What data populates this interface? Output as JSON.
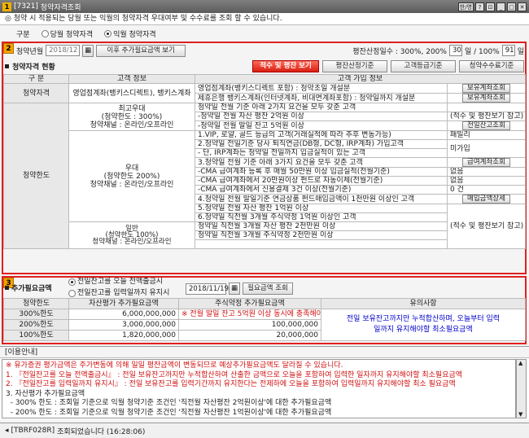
{
  "window": {
    "screen_no": "7321",
    "title": "청약자격조회",
    "btn_lang": "한/영",
    "btn_help": "?"
  },
  "notice": "◎ 청약 시 적용되는 당월 또는 익월의 청약자격 우대여부 및 수수료를 조회 할 수 있습니다.",
  "type_row": {
    "label": "구분",
    "opt1": "당월 청약자격",
    "opt2": "익월 청약자격"
  },
  "section2": {
    "badge": "2",
    "ym_label": "청약년월",
    "ym_value": "2018/12",
    "btn_need": "이후 추가필요금액 보기",
    "avg_label": "평잔산정일수 : 300%, 200%",
    "avg_v1": "30",
    "avg_mid": "일 / 100%",
    "avg_v2": "91",
    "avg_suffix": "일",
    "status_title": "청약자격 현황",
    "btn_red": "적수 및 평잔 보기",
    "btn_calc": "평잔산정기준",
    "btn_grade": "고객등급기준",
    "btn_fee": "청약수수료기준",
    "col1": "구 분",
    "col2": "고객 정보",
    "col3": "고객 가입 정보",
    "q_label": "청약자격",
    "q_info": "영업점계좌(뱅키스디렉트), 뱅키스계좌",
    "q_r1": "영업점계좌(뱅키스디렉트 포함)          : 청약초일 개설분",
    "q_r2": "제휴은행 뱅키스계좌(인터넷계좌, 비대면계좌포함) : 청약일까지 개설분",
    "btn_acct": "보유계좌조회",
    "limit_label": "청약한도",
    "top": {
      "name": "최고우대",
      "limit": "(청약한도 : 300%)",
      "ch": "청약채널 : 온라인/오프라인",
      "l1": "청약일 전월 기준 아래 2가지 요건을 모두 갖춘 고객",
      "l2": "-청약일 전월 자산 평잔 2억원 이상",
      "l3": "-청약일 전월 말일 잔고 5억원 이상",
      "note": "(적수 및 평잔보기 참고)",
      "btn": "전일잔고조회"
    },
    "pref": {
      "name": "우대",
      "limit": "(청약한도 200%)",
      "ch": "청약채널 : 온라인/오프라인",
      "l1": "1.VIP, 로얄, 골드 등급의 고객(거래실적에 따라 추후 변동가능)",
      "l1v": "패밀리",
      "l2": "2.청약일 전일기준 당사 퇴직연금(DB형, DC형, IRP계좌) 가입고객",
      "l2v": "미가입",
      "l3": "- 단, IRP계좌는 청약일 전일까지 입금실적이 있는 고객",
      "l4": "3.청약일 전월 기준 아래 3가지 요건을 모두 갖춘 고객",
      "btn_pay": "급여계좌조회",
      "l5": "-CMA 급여계좌 등록 후 매월 50만원 이상 입금실적(전월기준)",
      "l5v": "없음",
      "l6": "-CMA 급여계좌에서 20만원이상 펀드로 자동이체(전월기준)",
      "l6v": "없음",
      "l7": "-CMA 급여계좌에서 신용결제 3건 이상(전월기준)",
      "l7v": "0 건",
      "l8": "4.청약일 전월 말일기준 연금상품 펀드매입금액이 1천만원 이상인 고객",
      "btn_buy": "매입금액상세",
      "l9": "5.청약일 전월 자산 평잔 1억원 이상",
      "l10": "6.청약일 직전월 3개월 주식약정 1억원 이상인 고객"
    },
    "gen": {
      "name": "일반",
      "limit": "(청약한도 100%)",
      "ch": "청약채널 : 온라인/오프라인",
      "l1": "청약일 직전월 3개월 자산 평잔 2천만원 이상",
      "l2": "청약일 직전월 3개월 주식약정 2천만원 이상",
      "note": "(적수 및 평잔보기 참고)"
    }
  },
  "section3": {
    "badge": "3",
    "title": "추가필요금액",
    "opt1": "전일잔고를 오늘 전액출금시",
    "opt2": "전일잔고를 입력일까지 유지시",
    "date": "2018/11/19",
    "btn": "필요금액 조회",
    "h1": "청약한도",
    "h2": "자산평가 추가필요금액",
    "h3": "주식약정 추가필요금액",
    "h4": "유의사항",
    "warn": "※ 전월 말일 잔고 5억원 이상 동시에 충족해야 함",
    "rows": [
      {
        "limit": "300%한도",
        "asset": "6,000,000,000",
        "stock": ""
      },
      {
        "limit": "200%한도",
        "asset": "3,000,000,000",
        "stock": "100,000,000"
      },
      {
        "limit": "100%한도",
        "asset": "1,820,000,000",
        "stock": "20,000,000"
      }
    ],
    "caution": "전일 보유잔고까지만 누적합산하며, 오늘부터 입력일까지 유지해야할 최소필요금액"
  },
  "usage": {
    "title": "[이용안내]",
    "lines": [
      "※ 유가증권 평가금액은 주가변동에 의해 일일 평잔금액이 변동되므로 예상추가필요금액도 달라질 수 있습니다.",
      "1. 『전일잔고를 오늘 전액출금시』 : 전일 보유잔고까지만 누적합산하여 산출한 금액으로 오늘을 포함하여 입력한 일자까지 유지해야할 최소필요금액",
      "2. 『전일잔고를 입력일까지 유지시』 : 전일 보유잔고를 입력기간까지 유지한다는 전제하에 오늘을 포함하여 입력일까지 유지해야할 최소 필요금액",
      "3. 자산평가 추가필요금액",
      "  - 300% 한도 : 조회일 기준으로 익월 청약기준 조건인 '직전월 자산평잔 2억원이상'에 대한 추가필요금액",
      "  - 200% 한도 : 조회일 기준으로 익월 청약기준 조건인 '직전월 자산평잔 1억원이상'에 대한 추가필요금액"
    ]
  },
  "status": {
    "code": "[TBRF028R]",
    "msg": "조회되었습니다 (16:28:06)"
  },
  "colors": {
    "accent_red": "#e02020",
    "badge": "#f2a200",
    "link_blue": "#0000cc"
  }
}
